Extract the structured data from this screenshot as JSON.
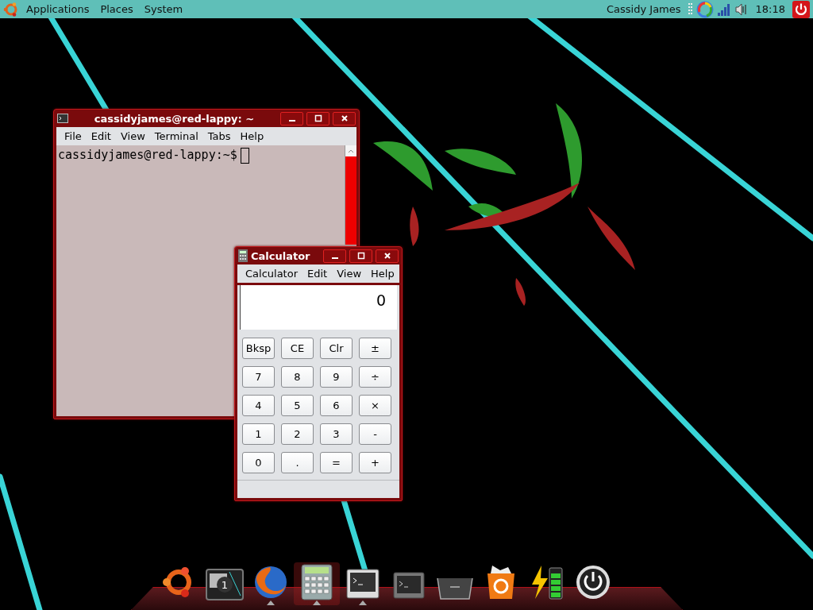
{
  "top_panel": {
    "menus": [
      "Applications",
      "Places",
      "System"
    ],
    "user": "Cassidy James",
    "clock": "18:18"
  },
  "terminal": {
    "title": "cassidyjames@red-lappy: ~",
    "menus": [
      "File",
      "Edit",
      "View",
      "Terminal",
      "Tabs",
      "Help"
    ],
    "prompt": "cassidyjames@red-lappy:~$"
  },
  "calculator": {
    "title": "Calculator",
    "menus": [
      "Calculator",
      "Edit",
      "View",
      "Help"
    ],
    "display": "0",
    "keys": [
      [
        "Bksp",
        "CE",
        "Clr",
        "±"
      ],
      [
        "7",
        "8",
        "9",
        "÷"
      ],
      [
        "4",
        "5",
        "6",
        "×"
      ],
      [
        "1",
        "2",
        "3",
        "-"
      ],
      [
        "0",
        ".",
        "=",
        "+"
      ]
    ]
  },
  "dock": {
    "items": [
      {
        "kind": "ubuntu",
        "running": false,
        "selected": false
      },
      {
        "kind": "workspace",
        "badge": "1",
        "running": false,
        "selected": false
      },
      {
        "kind": "browser",
        "running": true,
        "selected": false
      },
      {
        "kind": "calculator",
        "running": true,
        "selected": true
      },
      {
        "kind": "terminal",
        "running": true,
        "selected": false
      },
      {
        "kind": "terminal-small",
        "running": false,
        "selected": false
      },
      {
        "kind": "tray",
        "running": false,
        "selected": false
      },
      {
        "kind": "recycle",
        "running": false,
        "selected": false
      },
      {
        "kind": "battery",
        "running": false,
        "selected": false
      },
      {
        "kind": "power",
        "running": false,
        "selected": false
      }
    ]
  }
}
